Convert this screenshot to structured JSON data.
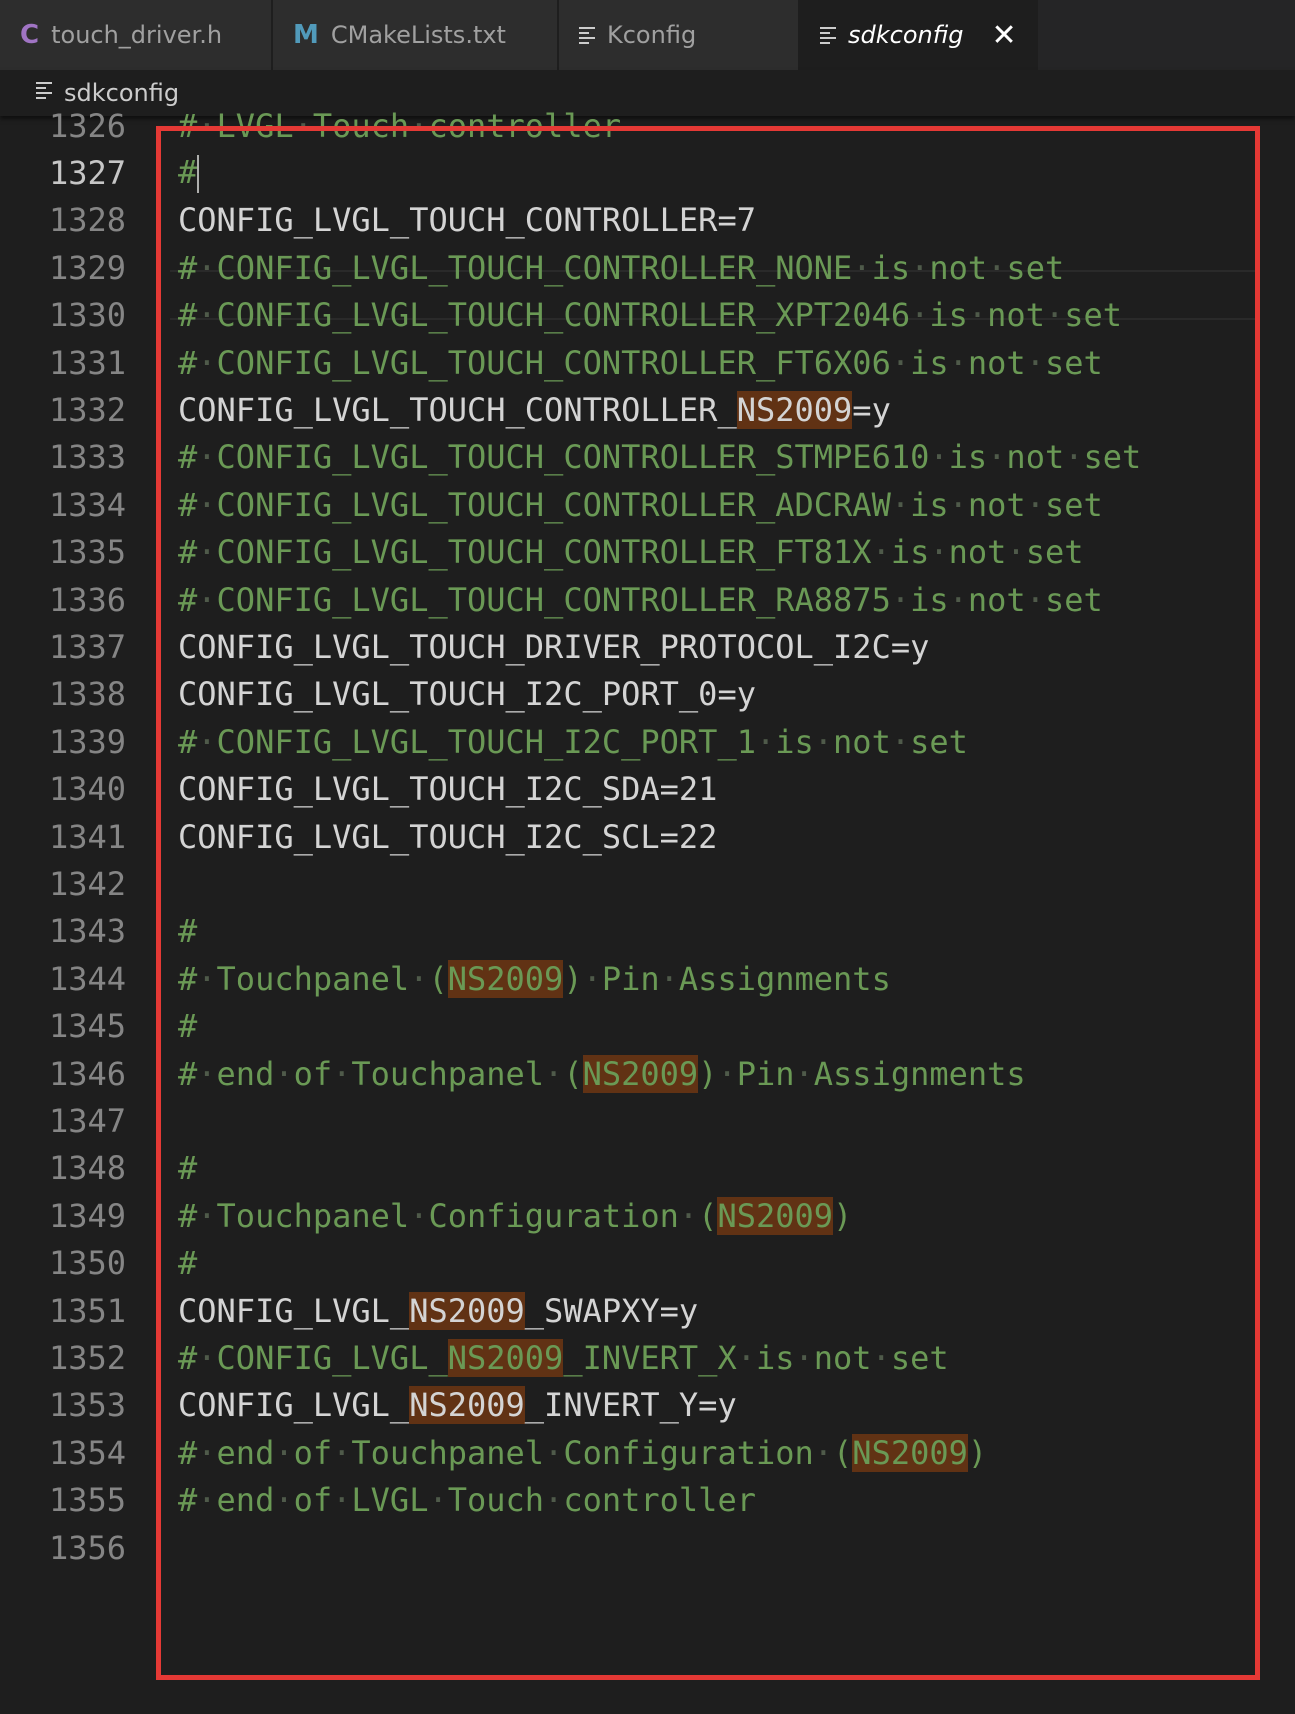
{
  "tabs": [
    {
      "label": "touch_driver.h",
      "icon": "c-file-icon",
      "width": 273
    },
    {
      "label": "CMakeLists.txt",
      "icon": "cmake-file-icon",
      "width": 286
    },
    {
      "label": "Kconfig",
      "icon": "text-file-icon",
      "width": 241
    },
    {
      "label": "sdkconfig",
      "icon": "text-file-icon",
      "width": 238,
      "active": true
    }
  ],
  "tab_icons": {
    "c": "C",
    "m": "M"
  },
  "breadcrumb": {
    "label": "sdkconfig"
  },
  "editor": {
    "current_line": 1327,
    "lines": [
      {
        "n": "1326",
        "text": "# LVGL Touch controller",
        "comment": true
      },
      {
        "n": "1327",
        "text": "#",
        "comment": true,
        "cursor": true
      },
      {
        "n": "1328",
        "text": "CONFIG_LVGL_TOUCH_CONTROLLER=7"
      },
      {
        "n": "1329",
        "text": "# CONFIG_LVGL_TOUCH_CONTROLLER_NONE is not set",
        "comment": true
      },
      {
        "n": "1330",
        "text": "# CONFIG_LVGL_TOUCH_CONTROLLER_XPT2046 is not set",
        "comment": true
      },
      {
        "n": "1331",
        "text": "# CONFIG_LVGL_TOUCH_CONTROLLER_FT6X06 is not set",
        "comment": true
      },
      {
        "n": "1332",
        "text": "CONFIG_LVGL_TOUCH_CONTROLLER_NS2009=y"
      },
      {
        "n": "1333",
        "text": "# CONFIG_LVGL_TOUCH_CONTROLLER_STMPE610 is not set",
        "comment": true
      },
      {
        "n": "1334",
        "text": "# CONFIG_LVGL_TOUCH_CONTROLLER_ADCRAW is not set",
        "comment": true
      },
      {
        "n": "1335",
        "text": "# CONFIG_LVGL_TOUCH_CONTROLLER_FT81X is not set",
        "comment": true
      },
      {
        "n": "1336",
        "text": "# CONFIG_LVGL_TOUCH_CONTROLLER_RA8875 is not set",
        "comment": true
      },
      {
        "n": "1337",
        "text": "CONFIG_LVGL_TOUCH_DRIVER_PROTOCOL_I2C=y"
      },
      {
        "n": "1338",
        "text": "CONFIG_LVGL_TOUCH_I2C_PORT_0=y"
      },
      {
        "n": "1339",
        "text": "# CONFIG_LVGL_TOUCH_I2C_PORT_1 is not set",
        "comment": true
      },
      {
        "n": "1340",
        "text": "CONFIG_LVGL_TOUCH_I2C_SDA=21"
      },
      {
        "n": "1341",
        "text": "CONFIG_LVGL_TOUCH_I2C_SCL=22"
      },
      {
        "n": "1342",
        "text": ""
      },
      {
        "n": "1343",
        "text": "#",
        "comment": true
      },
      {
        "n": "1344",
        "text": "# Touchpanel (NS2009) Pin Assignments",
        "comment": true
      },
      {
        "n": "1345",
        "text": "#",
        "comment": true
      },
      {
        "n": "1346",
        "text": "# end of Touchpanel (NS2009) Pin Assignments",
        "comment": true
      },
      {
        "n": "1347",
        "text": ""
      },
      {
        "n": "1348",
        "text": "#",
        "comment": true
      },
      {
        "n": "1349",
        "text": "# Touchpanel Configuration (NS2009)",
        "comment": true
      },
      {
        "n": "1350",
        "text": "#",
        "comment": true
      },
      {
        "n": "1351",
        "text": "CONFIG_LVGL_NS2009_SWAPXY=y"
      },
      {
        "n": "1352",
        "text": "# CONFIG_LVGL_NS2009_INVERT_X is not set",
        "comment": true
      },
      {
        "n": "1353",
        "text": "CONFIG_LVGL_NS2009_INVERT_Y=y"
      },
      {
        "n": "1354",
        "text": "# end of Touchpanel Configuration (NS2009)",
        "comment": true
      },
      {
        "n": "1355",
        "text": "# end of LVGL Touch controller",
        "comment": true
      },
      {
        "n": "1356",
        "text": ""
      }
    ],
    "search_highlight": "NS2009"
  },
  "colors": {
    "background": "#1e1e1e",
    "comment": "#6a9955",
    "text": "#d4d4d4",
    "line_number": "#858585",
    "match_highlight": "#613214",
    "annotation_box": "#e53935"
  }
}
